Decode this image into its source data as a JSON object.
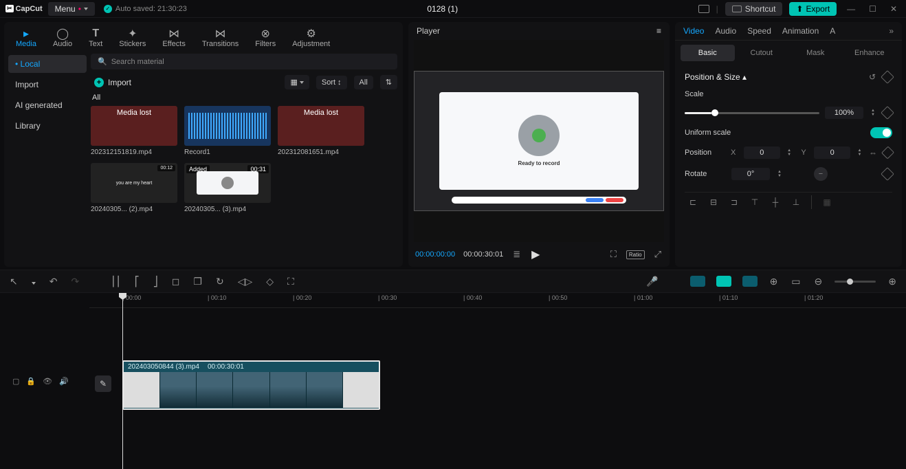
{
  "app": {
    "name": "CapCut",
    "menu": "Menu",
    "autosave": "Auto saved: 21:30:23",
    "title": "0128 (1)"
  },
  "title_actions": {
    "shortcut": "Shortcut",
    "export": "Export"
  },
  "mediaTabs": {
    "media": "Media",
    "audio": "Audio",
    "text": "Text",
    "stickers": "Stickers",
    "effects": "Effects",
    "transitions": "Transitions",
    "filters": "Filters",
    "adjustment": "Adjustment"
  },
  "mediaSide": {
    "local": "Local",
    "import": "Import",
    "ai": "AI generated",
    "library": "Library"
  },
  "mediaPanel": {
    "search": "Search material",
    "import": "Import",
    "sort": "Sort",
    "all": "All",
    "tabAll": "All"
  },
  "clips": {
    "c1": {
      "lost": "Media lost",
      "name": "202312151819.mp4"
    },
    "c2": {
      "name": "Record1"
    },
    "c3": {
      "lost": "Media lost",
      "name": "202312081651.mp4"
    },
    "c4": {
      "dur": "00:12",
      "name": "20240305... (2).mp4",
      "heart": "you are my heart"
    },
    "c5": {
      "badge": "Added",
      "dur": "00:31",
      "name": "20240305... (3).mp4"
    }
  },
  "player": {
    "title": "Player",
    "tc1": "00:00:00:00",
    "tc2": "00:00:30:01",
    "vp_text": "Ready to record",
    "ratio": "Ratio"
  },
  "right": {
    "tabs": {
      "video": "Video",
      "audio": "Audio",
      "speed": "Speed",
      "animation": "Animation"
    },
    "sub": {
      "basic": "Basic",
      "cutout": "Cutout",
      "mask": "Mask",
      "enhance": "Enhance"
    },
    "sec": "Position & Size",
    "scale": "Scale",
    "scale_v": "100%",
    "uniform": "Uniform scale",
    "position": "Position",
    "px": "0",
    "py": "0",
    "x": "X",
    "y": "Y",
    "rotate": "Rotate",
    "rot_v": "0°"
  },
  "timelineClip": {
    "name": "202403050844 (3).mp4",
    "dur": "00:00:30:01"
  },
  "ruler": [
    "00:00",
    "00:10",
    "00:20",
    "00:30",
    "00:40",
    "00:50",
    "01:00",
    "01:10",
    "01:20"
  ]
}
